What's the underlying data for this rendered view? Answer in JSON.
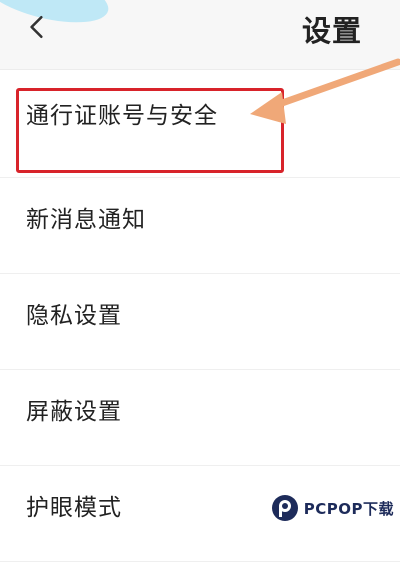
{
  "header": {
    "title": "设置",
    "back_icon": "chevron-left-icon"
  },
  "settings": {
    "items": [
      {
        "label": "通行证账号与安全"
      },
      {
        "label": "新消息通知"
      },
      {
        "label": "隐私设置"
      },
      {
        "label": "屏蔽设置"
      },
      {
        "label": "护眼模式"
      }
    ]
  },
  "annotation": {
    "highlight_color": "#d8232a",
    "arrow_color": "#f0a878"
  },
  "watermark": {
    "text": "PCPOP下载",
    "color": "#1d2b5a"
  }
}
